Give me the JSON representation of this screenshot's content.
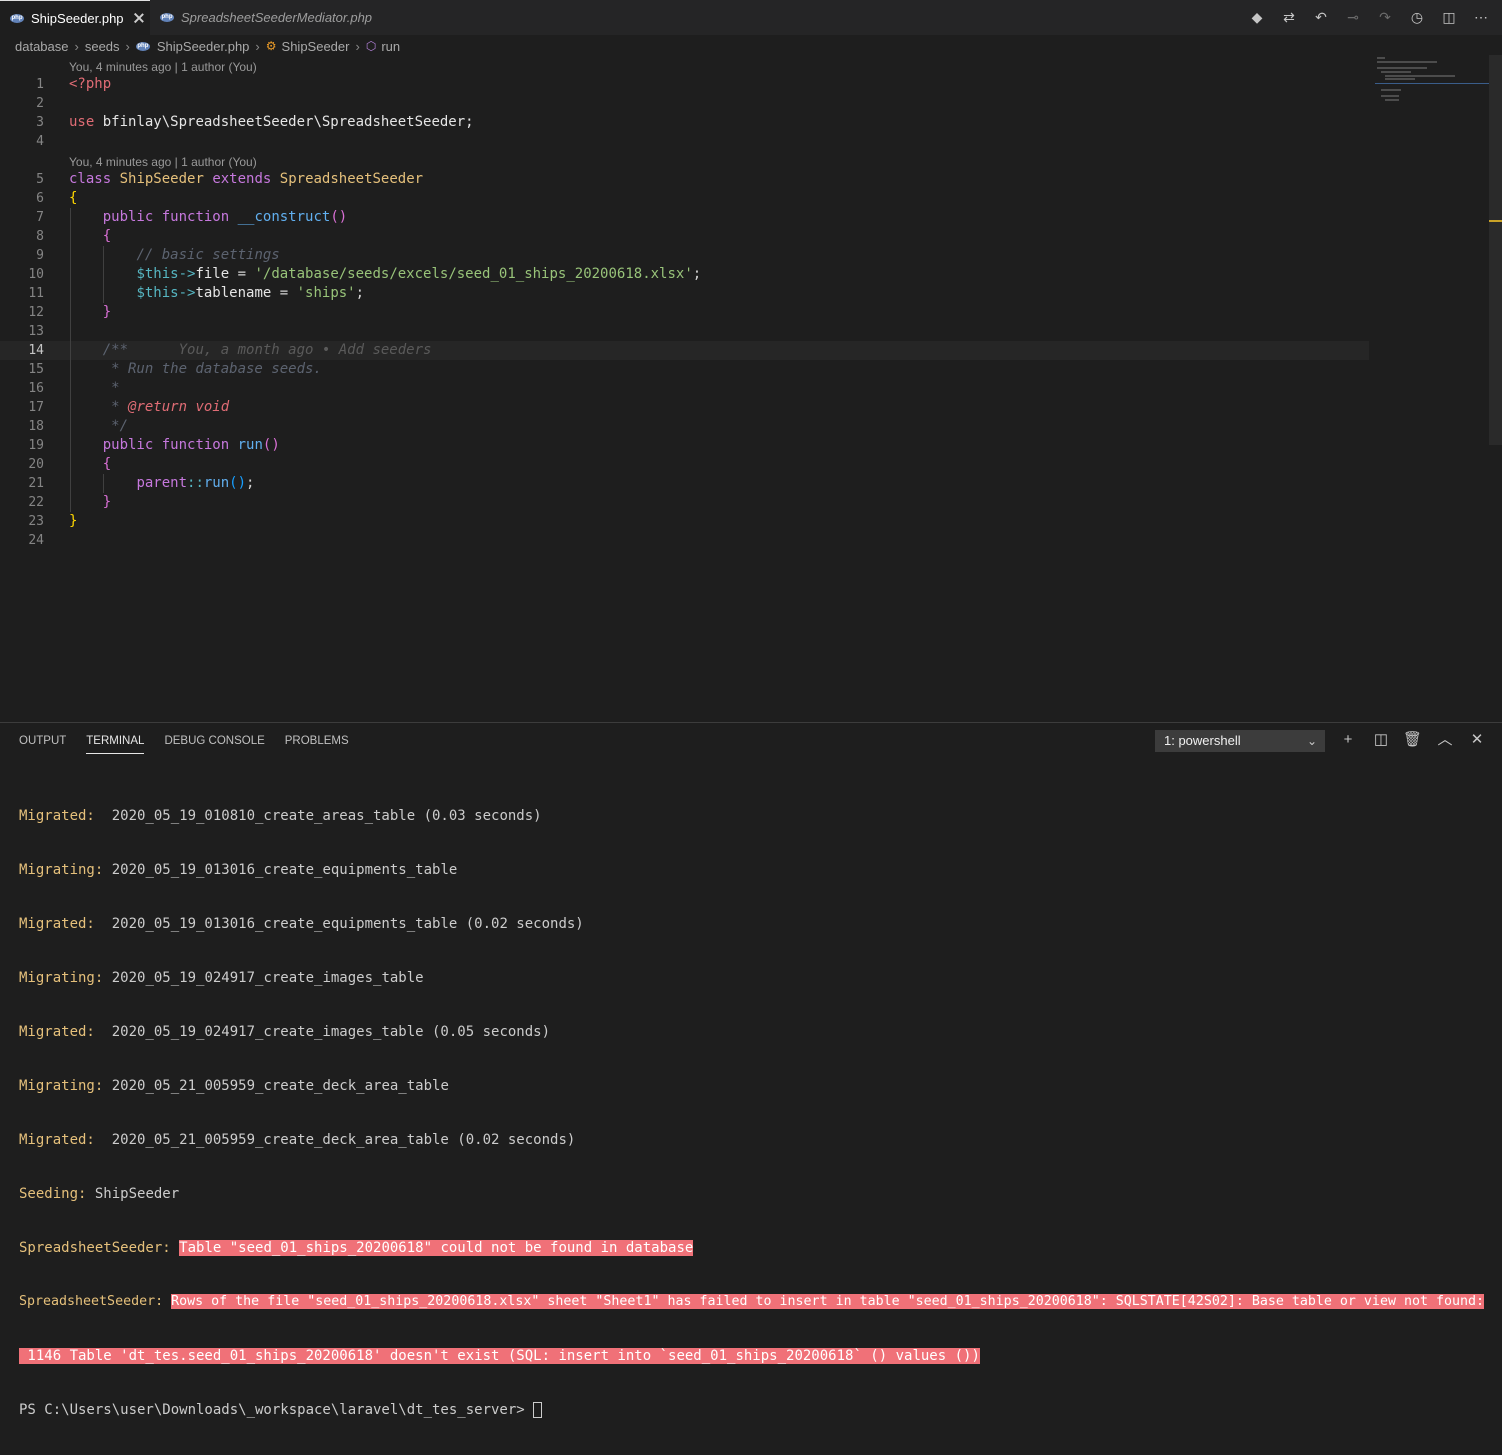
{
  "tabs": [
    {
      "label": "ShipSeeder.php",
      "active": true
    },
    {
      "label": "SpreadsheetSeederMediator.php",
      "active": false
    }
  ],
  "breadcrumb": [
    "database",
    "seeds",
    "ShipSeeder.php",
    "ShipSeeder",
    "run"
  ],
  "codelens": {
    "top": "You, 4 minutes ago | 1 author (You)",
    "class": "You, 4 minutes ago | 1 author (You)"
  },
  "code": {
    "l1": "<?php",
    "l3_use": "use",
    "l3_ns": "bfinlay\\SpreadsheetSeeder\\SpreadsheetSeeder;",
    "l5_class": "class",
    "l5_name": "ShipSeeder",
    "l5_extends": "extends",
    "l5_parent": "SpreadsheetSeeder",
    "l7_public": "public",
    "l7_function": "function",
    "l7_name": "__construct",
    "l9": "// basic settings",
    "l10_this": "$this->",
    "l10_prop": "file",
    "l10_str": "'/database/seeds/excels/seed_01_ships_20200618.xlsx'",
    "l11_this": "$this->",
    "l11_prop": "tablename",
    "l11_str": "'ships'",
    "l14": "/**",
    "l14_blame": "You, a month ago • Add seeders",
    "l15": " * Run the database seeds.",
    "l16": " *",
    "l17_star": " * ",
    "l17_tag": "@return void",
    "l18": " */",
    "l19_public": "public",
    "l19_function": "function",
    "l19_name": "run",
    "l21_parent": "parent",
    "l21_call": "run"
  },
  "panel": {
    "tabs": [
      "OUTPUT",
      "TERMINAL",
      "DEBUG CONSOLE",
      "PROBLEMS"
    ],
    "active_tab": "TERMINAL",
    "terminal_select": "1: powershell"
  },
  "terminal": [
    {
      "label": "Migrated:",
      "text": "  2020_05_19_010810_create_areas_table (0.03 seconds)"
    },
    {
      "label": "Migrating:",
      "text": " 2020_05_19_013016_create_equipments_table"
    },
    {
      "label": "Migrated:",
      "text": "  2020_05_19_013016_create_equipments_table (0.02 seconds)"
    },
    {
      "label": "Migrating:",
      "text": " 2020_05_19_024917_create_images_table"
    },
    {
      "label": "Migrated:",
      "text": "  2020_05_19_024917_create_images_table (0.05 seconds)"
    },
    {
      "label": "Migrating:",
      "text": " 2020_05_21_005959_create_deck_area_table"
    },
    {
      "label": "Migrated:",
      "text": "  2020_05_21_005959_create_deck_area_table (0.02 seconds)"
    },
    {
      "label": "Seeding:",
      "text": " ShipSeeder"
    },
    {
      "label": "SpreadsheetSeeder:",
      "err": "Table \"seed_01_ships_20200618\" could not be found in database"
    },
    {
      "label": "SpreadsheetSeeder:",
      "err": "Rows of the file \"seed_01_ships_20200618.xlsx\" sheet \"Sheet1\" has failed to insert in table \"seed_01_ships_20200618\": SQLSTATE[42S02]: Base table or view not found:"
    },
    {
      "err": " 1146 Table 'dt_tes.seed_01_ships_20200618' doesn't exist (SQL: insert into `seed_01_ships_20200618` () values ())"
    },
    {
      "prompt": "PS C:\\Users\\user\\Downloads\\_workspace\\laravel\\dt_tes_server> "
    }
  ]
}
